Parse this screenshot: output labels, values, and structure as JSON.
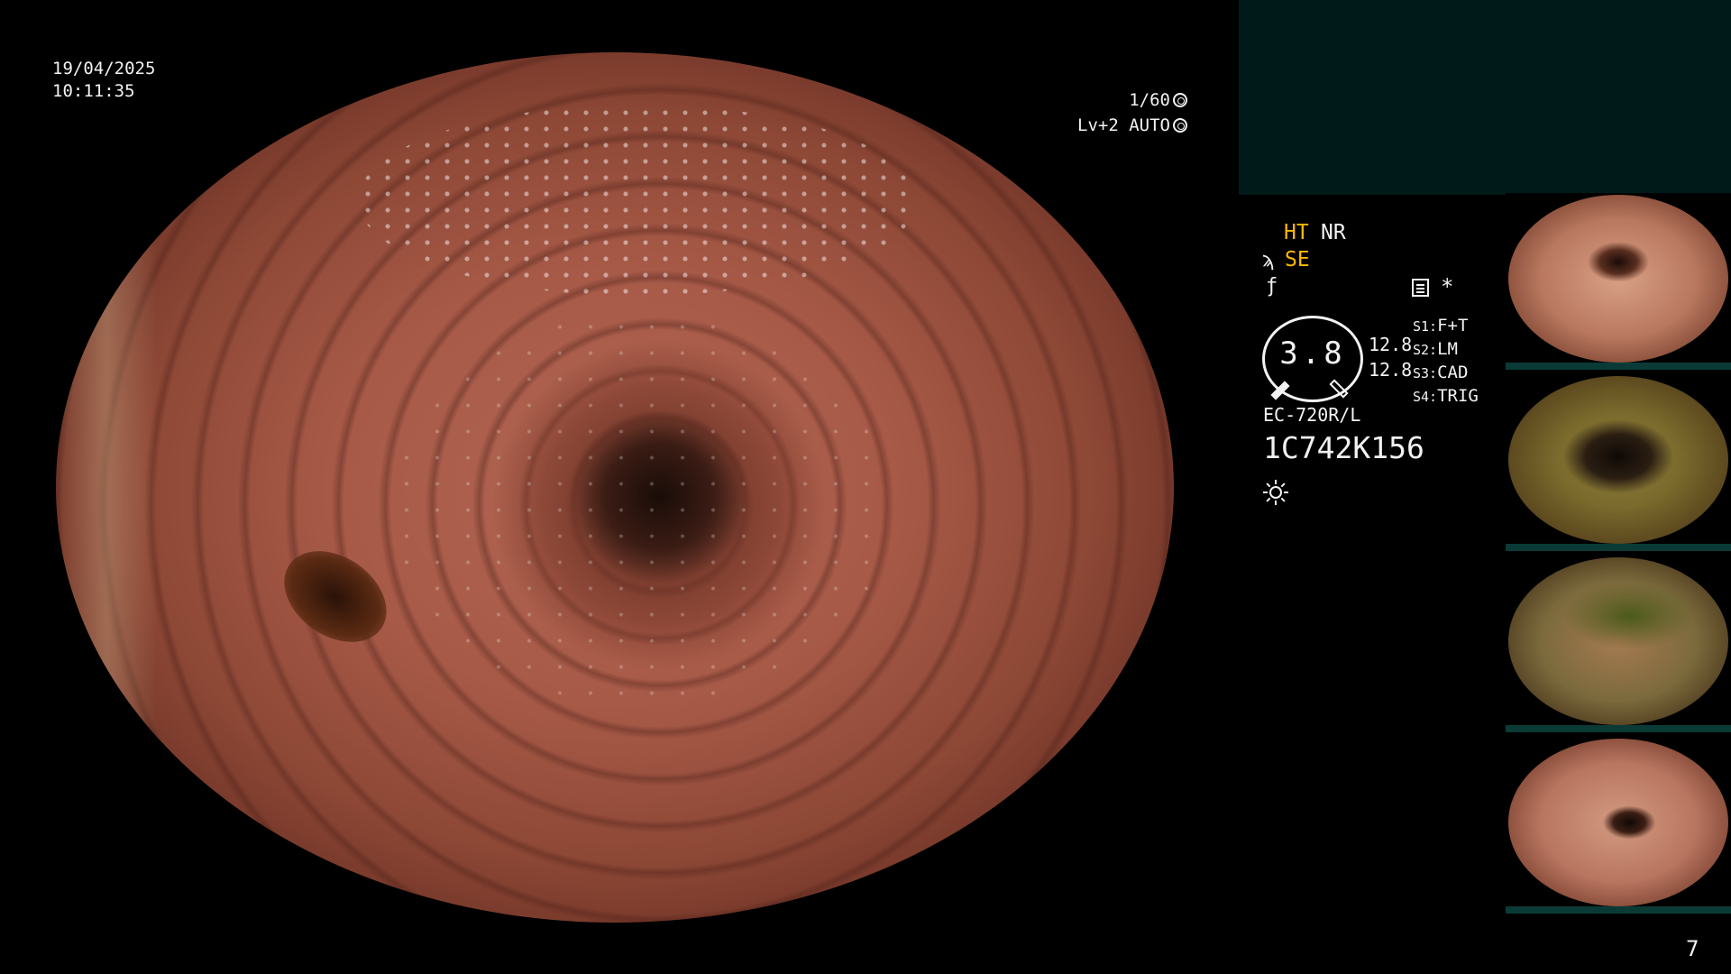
{
  "overlay": {
    "date": "19/04/2025",
    "time": "10:11:35",
    "shutter": "1/60",
    "light_level": "Lv+2 AUTO"
  },
  "modes": {
    "ht": "HT",
    "nr": "NR",
    "se_icon": "ϡ",
    "se": "SE",
    "flash_icon": "ƒ",
    "asterisk": "*"
  },
  "colors": {
    "accent": "#ffb900",
    "text": "#f2f2f2",
    "info_box": "#001a19",
    "thumb_bar": "#0a3a36"
  },
  "dial": {
    "value": "3.8",
    "side_top": "12.8",
    "side_bottom": "12.8"
  },
  "settings": [
    {
      "key": "S1:",
      "value": "F+T"
    },
    {
      "key": "S2:",
      "value": "LM"
    },
    {
      "key": "S3:",
      "value": "CAD"
    },
    {
      "key": "S4:",
      "value": "TRIG"
    }
  ],
  "scope": {
    "model": "EC-720R/L",
    "serial": "1C742K156"
  },
  "icons": {
    "shutter": "shutter-icon",
    "light": "light-icon",
    "memo": "memo-icon",
    "sun": "sun-icon"
  },
  "page_number": "7"
}
